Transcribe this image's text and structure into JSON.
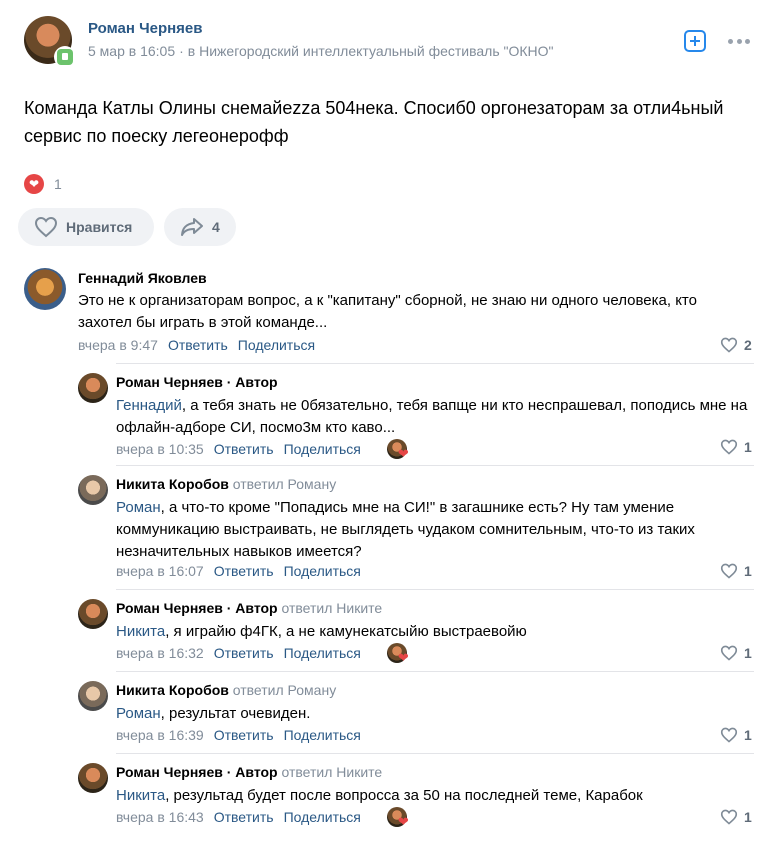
{
  "post": {
    "author": "Роман Черняев",
    "date": "5 мар в 16:05",
    "separator": "·",
    "community": "в Нижегородский интеллектуальный фестиваль \"ОКНО\"",
    "text": "Команда Катлы Олины снемайezza 504нека. Спосиб0 оргонезаторам за отли4ьный сервис по поеску легеонерофф",
    "reactions_count": "1",
    "like_label": "Нравится",
    "share_count": "4"
  },
  "comments": [
    {
      "author": "Геннадий Яковлев",
      "text": "Это не к организаторам вопрос, а к \"капитану\" сборной, не знаю ни одного человека, кто захотел бы играть в этой команде...",
      "time": "вчера в 9:47",
      "reply": "Ответить",
      "share": "Поделиться",
      "likes": "2"
    },
    {
      "author": "Роман Черняев · Автор",
      "mention": "Геннадий",
      "text": ", а тебя знать не 0бязательно, тебя вапще ни кто неспрашевал, поподись мне на офлайн-адборе СИ, посмо3м кто каво...",
      "time": "вчера в 10:35",
      "reply": "Ответить",
      "share": "Поделиться",
      "likes": "1"
    },
    {
      "author": "Никита Коробов",
      "replied_to": "ответил Роману",
      "mention": "Роман",
      "text": ", а что-то кроме \"Попадись мне на СИ!\" в загашнике есть? Ну там умение коммуникацию выстраивать, не выглядеть чудаком сомнительным, что-то из таких незначительных навыков имеется?",
      "time": "вчера в 16:07",
      "reply": "Ответить",
      "share": "Поделиться",
      "likes": "1"
    },
    {
      "author": "Роман Черняев · Автор",
      "replied_to": "ответил Никите",
      "mention": "Никита",
      "text": ", я играйю ф4ГК, а не камунекатсыйю выстраевойю",
      "time": "вчера в 16:32",
      "reply": "Ответить",
      "share": "Поделиться",
      "likes": "1"
    },
    {
      "author": "Никита Коробов",
      "replied_to": "ответил Роману",
      "mention": "Роман",
      "text": ", результат очевиден.",
      "time": "вчера в 16:39",
      "reply": "Ответить",
      "share": "Поделиться",
      "likes": "1"
    },
    {
      "author": "Роман Черняев · Автор",
      "replied_to": "ответил Никите",
      "mention": "Никита",
      "text": ", результад будет после вопросса за 50 на последней теме, Карабок",
      "time": "вчера в 16:43",
      "reply": "Ответить",
      "share": "Поделиться",
      "likes": "1"
    }
  ],
  "colors": {
    "link": "#2a5885",
    "meta": "#818c99",
    "heart": "#e64646",
    "accent": "#2688eb",
    "button_bg": "#f0f2f5"
  }
}
